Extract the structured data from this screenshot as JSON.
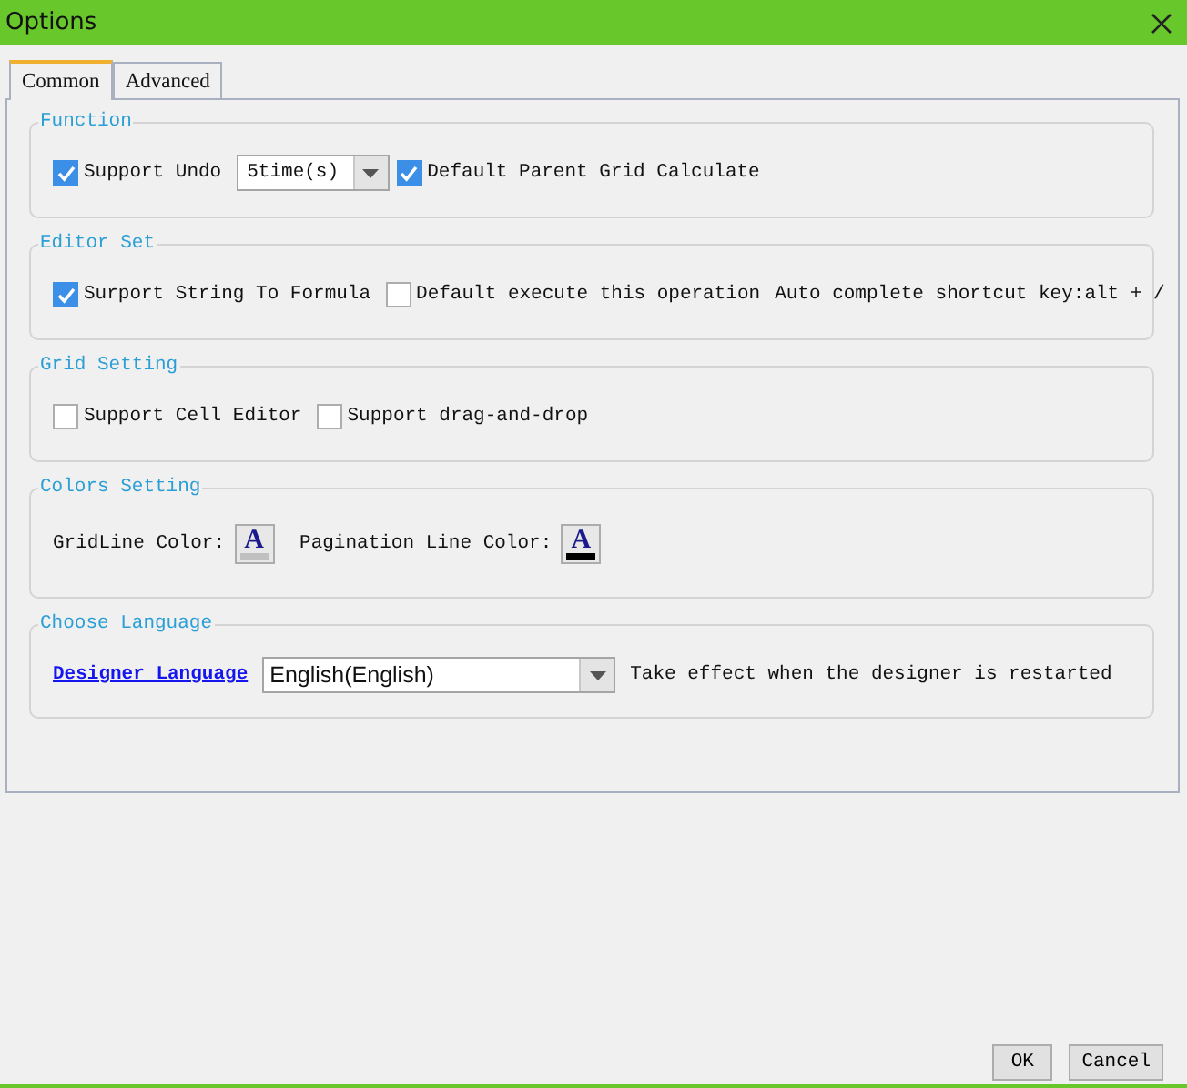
{
  "window": {
    "title": "Options"
  },
  "tabs": [
    {
      "label": "Common",
      "selected": true
    },
    {
      "label": "Advanced",
      "selected": false
    }
  ],
  "groups": [
    {
      "title": "Function",
      "items": [
        {
          "kind": "checkbox",
          "label": "Support Undo",
          "checked": true
        },
        {
          "kind": "dropdown",
          "value": "5time(s)"
        },
        {
          "kind": "checkbox",
          "label": "Default Parent Grid Calculate",
          "checked": true
        }
      ]
    },
    {
      "title": "Editor Set",
      "items": [
        {
          "kind": "checkbox",
          "label": "Surport String To Formula",
          "checked": true
        },
        {
          "kind": "checkbox",
          "label": "Default execute this operation",
          "checked": false
        },
        {
          "kind": "text",
          "label": "Auto complete shortcut key:alt + /"
        }
      ]
    },
    {
      "title": "Grid Setting",
      "items": [
        {
          "kind": "checkbox",
          "label": "Support Cell Editor",
          "checked": false
        },
        {
          "kind": "checkbox",
          "label": "Support drag-and-drop",
          "checked": false
        }
      ]
    },
    {
      "title": "Colors Setting",
      "items": [
        {
          "kind": "text",
          "label": "GridLine Color:"
        },
        {
          "kind": "color",
          "glyph": "A",
          "color": "#c0c0c0"
        },
        {
          "kind": "text",
          "label": "Pagination Line Color:"
        },
        {
          "kind": "color",
          "glyph": "A",
          "color": "#000000"
        }
      ]
    },
    {
      "title": "Choose Language",
      "items": [
        {
          "kind": "link",
          "label": "Designer Language"
        },
        {
          "kind": "combobox",
          "value": "English(English)"
        },
        {
          "kind": "text",
          "label": "Take effect when the designer is restarted"
        }
      ]
    }
  ],
  "buttons": [
    "OK",
    "Cancel"
  ]
}
